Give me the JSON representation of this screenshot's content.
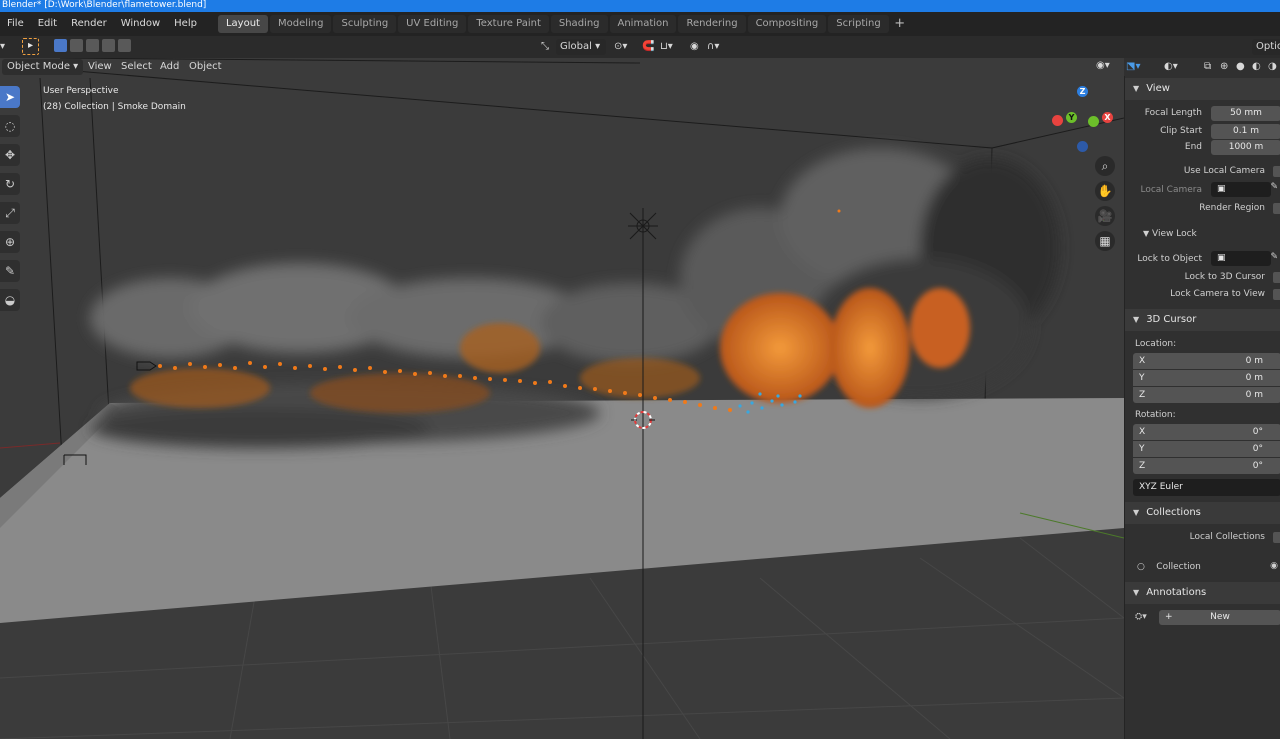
{
  "window": {
    "title": "Blender* [D:\\Work\\Blender\\flametower.blend]"
  },
  "menus": [
    "File",
    "Edit",
    "Render",
    "Window",
    "Help"
  ],
  "workspaces": [
    "Layout",
    "Modeling",
    "Sculpting",
    "UV Editing",
    "Texture Paint",
    "Shading",
    "Animation",
    "Rendering",
    "Compositing",
    "Scripting"
  ],
  "active_workspace": "Layout",
  "header": {
    "orientation": "Global",
    "options": "Optio",
    "mode": "Object Mode",
    "menus": [
      "View",
      "Select",
      "Add",
      "Object"
    ]
  },
  "viewport": {
    "perspective": "User Perspective",
    "collection_info": "(28) Collection | Smoke Domain",
    "gizmo": {
      "z": "Z",
      "y": "Y",
      "x": "X"
    }
  },
  "sidebar": {
    "view": {
      "title": "View",
      "focal_length_label": "Focal Length",
      "focal_length": "50 mm",
      "clip_start_label": "Clip Start",
      "clip_start": "0.1 m",
      "end_label": "End",
      "end": "1000 m",
      "use_local_camera": "Use Local Camera",
      "local_camera": "Local Camera",
      "render_region": "Render Region"
    },
    "view_lock": {
      "title": "View Lock",
      "lock_to_object": "Lock to Object",
      "lock_to_3d_cursor": "Lock to 3D Cursor",
      "lock_camera_to_view": "Lock Camera to View"
    },
    "cursor": {
      "title": "3D Cursor",
      "location_label": "Location:",
      "location": [
        {
          "axis": "X",
          "value": "0 m"
        },
        {
          "axis": "Y",
          "value": "0 m"
        },
        {
          "axis": "Z",
          "value": "0 m"
        }
      ],
      "rotation_label": "Rotation:",
      "rotation": [
        {
          "axis": "X",
          "value": "0°"
        },
        {
          "axis": "Y",
          "value": "0°"
        },
        {
          "axis": "Z",
          "value": "0°"
        }
      ],
      "rotation_mode": "XYZ Euler"
    },
    "collections": {
      "title": "Collections",
      "local_collections": "Local Collections",
      "item": "Collection"
    },
    "annotations": {
      "title": "Annotations",
      "new_button": "New"
    }
  },
  "colors": {
    "accent": "#1e7ce6",
    "active_tool": "#4a78c8",
    "fire": "#e07a20",
    "smoke": "#7a7a7a",
    "gizmo_x": "#e8433f",
    "gizmo_y": "#6cbf2a",
    "gizmo_z": "#2d7fe0"
  }
}
